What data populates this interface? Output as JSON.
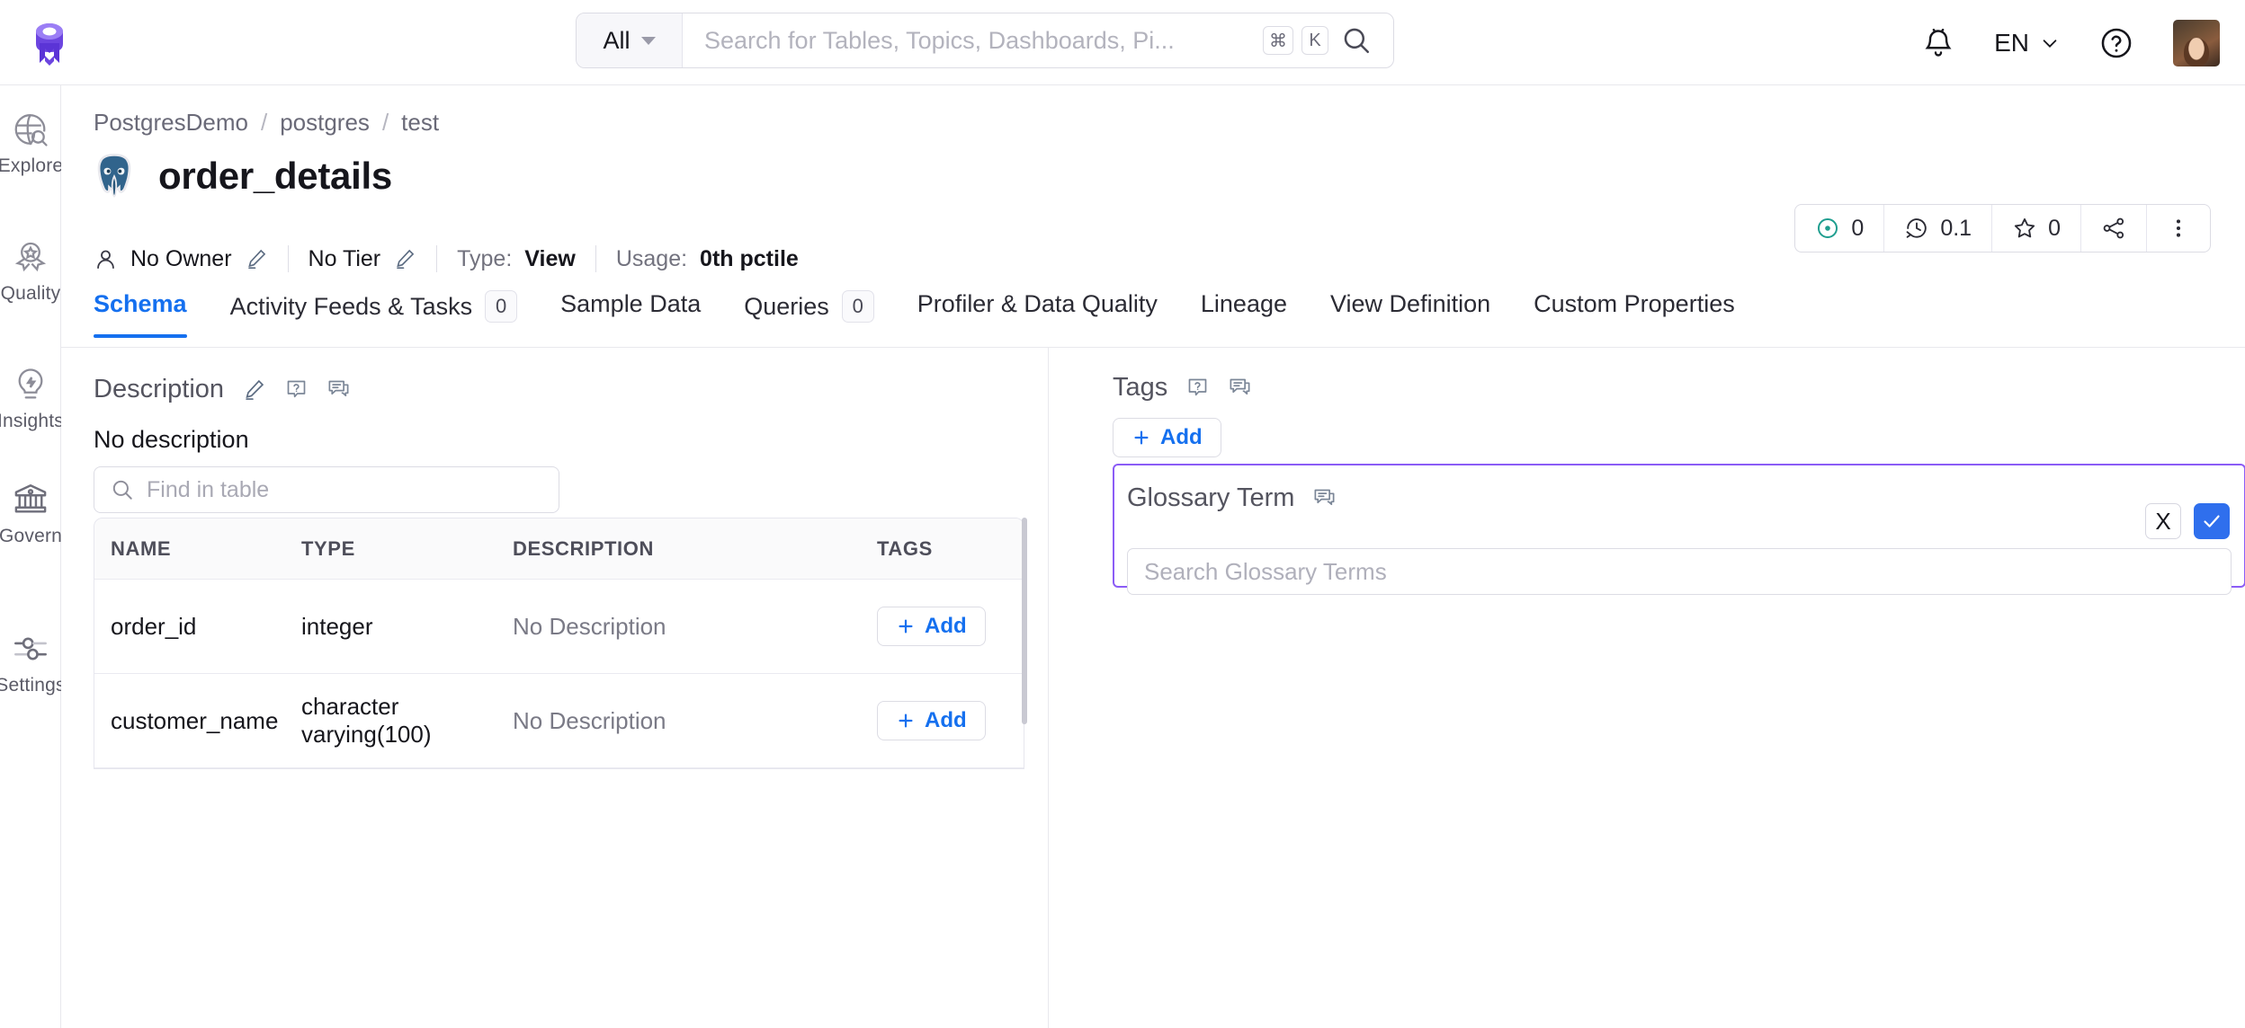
{
  "header": {
    "logo_icon": "openmetadata-logo",
    "search": {
      "scope_label": "All",
      "placeholder": "Search for Tables, Topics, Dashboards, Pi...",
      "value": "",
      "shortcut_mod": "⌘",
      "shortcut_key": "K",
      "search_icon": "search-icon"
    },
    "notifications_icon": "bell-icon",
    "language": "EN",
    "help_icon": "question-circle-icon",
    "avatar_icon": "user-avatar"
  },
  "sidebar": {
    "items": [
      {
        "label": "Explore",
        "icon": "globe-search-icon"
      },
      {
        "label": "Quality",
        "icon": "award-ribbon-icon"
      },
      {
        "label": "Insights",
        "icon": "lightbulb-icon"
      },
      {
        "label": "Govern",
        "icon": "bank-icon"
      },
      {
        "label": "Settings",
        "icon": "sliders-icon"
      }
    ]
  },
  "breadcrumb": {
    "items": [
      "PostgresDemo",
      "postgres",
      "test"
    ],
    "separator": "/"
  },
  "entity": {
    "icon": "postgres-elephant-icon",
    "title": "order_details",
    "owner_label": "No Owner",
    "owner_icon": "user-icon",
    "owner_edit_icon": "pencil-icon",
    "tier_label": "No Tier",
    "tier_edit_icon": "pencil-icon",
    "type_key": "Type:",
    "type_value": "View",
    "usage_key": "Usage:",
    "usage_value": "0th pctile"
  },
  "entity_actions": [
    {
      "name": "announcement",
      "icon": "target-dot-icon",
      "value": "0"
    },
    {
      "name": "version",
      "icon": "version-history-icon",
      "value": "0.1"
    },
    {
      "name": "follow",
      "icon": "star-icon",
      "value": "0"
    },
    {
      "name": "share",
      "icon": "share-icon",
      "value": ""
    },
    {
      "name": "more",
      "icon": "kebab-menu-icon",
      "value": ""
    }
  ],
  "tabs": [
    {
      "label": "Schema",
      "badge": null,
      "active": true
    },
    {
      "label": "Activity Feeds & Tasks",
      "badge": "0",
      "active": false
    },
    {
      "label": "Sample Data",
      "badge": null,
      "active": false
    },
    {
      "label": "Queries",
      "badge": "0",
      "active": false
    },
    {
      "label": "Profiler & Data Quality",
      "badge": null,
      "active": false
    },
    {
      "label": "Lineage",
      "badge": null,
      "active": false
    },
    {
      "label": "View Definition",
      "badge": null,
      "active": false
    },
    {
      "label": "Custom Properties",
      "badge": null,
      "active": false
    }
  ],
  "description": {
    "title": "Description",
    "edit_icon": "pencil-icon",
    "request_icon": "question-tooltip-icon",
    "comment_icon": "comment-icon",
    "body": "No description"
  },
  "find_in_table": {
    "placeholder": "Find in table",
    "value": "",
    "icon": "search-icon"
  },
  "columns_table": {
    "headers": [
      "NAME",
      "TYPE",
      "DESCRIPTION",
      "TAGS"
    ],
    "add_label": "Add",
    "add_icon": "plus-icon",
    "rows": [
      {
        "name": "order_id",
        "type": "integer",
        "description": "No Description"
      },
      {
        "name": "customer_name",
        "type": "character varying(100)",
        "description": "No Description"
      }
    ]
  },
  "tags_panel": {
    "title": "Tags",
    "request_icon": "question-tooltip-icon",
    "comment_icon": "comment-icon",
    "add_label": "Add",
    "add_icon": "plus-icon"
  },
  "glossary_panel": {
    "title": "Glossary Term",
    "comment_icon": "comment-icon",
    "cancel_label": "X",
    "cancel_icon": "close-icon",
    "save_icon": "check-icon",
    "search_placeholder": "Search Glossary Terms",
    "search_value": "",
    "border_color": "#8b5cf6",
    "save_color": "#2f6fed"
  },
  "colors": {
    "accent_blue": "#1570ef",
    "purple_brand": "#7147e8",
    "teal": "#1f9e8f",
    "postgres_blue": "#31648c"
  }
}
